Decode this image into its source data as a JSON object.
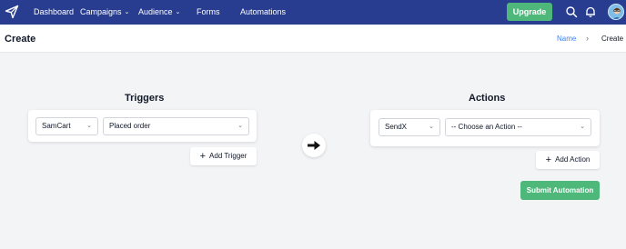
{
  "nav": {
    "items": [
      {
        "label": "Dashboard"
      },
      {
        "label": "Campaigns"
      },
      {
        "label": "Audience"
      },
      {
        "label": "Forms"
      },
      {
        "label": "Automations"
      }
    ],
    "upgrade_label": "Upgrade",
    "icons": [
      "paper-plane-icon",
      "search-icon",
      "bell-icon",
      "avatar"
    ]
  },
  "header": {
    "title": "Create",
    "breadcrumb": {
      "link": "Name",
      "separator": "›",
      "current": "Create"
    }
  },
  "triggers": {
    "title": "Triggers",
    "app_select": "SamCart",
    "event_select": "Placed order",
    "add_label": "Add Trigger"
  },
  "actions": {
    "title": "Actions",
    "app_select": "SendX",
    "action_select": "-- Choose an Action --",
    "add_label": "Add Action",
    "submit_label": "Submit Automation"
  },
  "colors": {
    "nav_bg": "#283d8f",
    "accent_green": "#4db87a",
    "link_blue": "#3b82f6",
    "page_bg": "#f3f4f6"
  }
}
